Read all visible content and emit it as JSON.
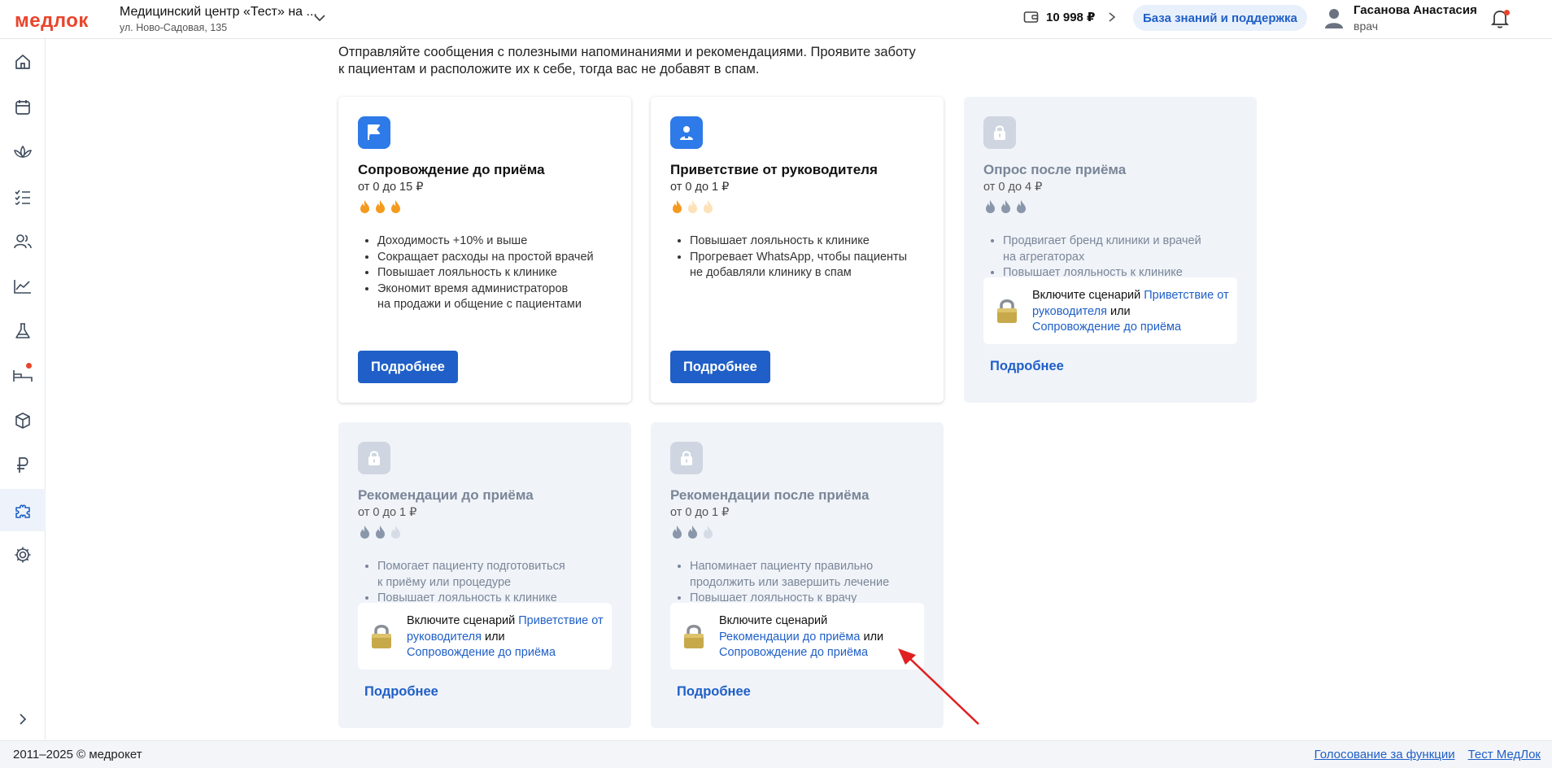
{
  "header": {
    "logo": "медлок",
    "clinic_name": "Медицинский центр «Тест» на ...",
    "clinic_address": "ул. Ново-Садовая, 135",
    "balance": "10 998 ₽",
    "knowledge_button": "База знаний и поддержка",
    "user_name": "Гасанова Анастасия",
    "user_role": "врач"
  },
  "sidebar": {
    "items": [
      "home-icon",
      "calendar-icon",
      "lotus-icon",
      "checklist-icon",
      "users-icon",
      "chart-icon",
      "flask-icon",
      "bed-icon",
      "box-icon",
      "ruble-icon",
      "puzzle-icon",
      "settings-icon"
    ],
    "active": "puzzle-icon",
    "expand_icon": "chevron-right-icon"
  },
  "intro": {
    "line1": "Отправляйте сообщения с полезными напоминаниями и рекомендациями. Проявите заботу",
    "line2": "к пациентам и расположите их к себе, тогда вас не добавят в спам."
  },
  "cards": [
    {
      "title": "Сопровождение до приёма",
      "price": "от 0 до 15 ₽",
      "flames_active": 3,
      "benefits": [
        "Доходимость +10% и выше",
        "Сокращает расходы на простой врачей",
        "Повышает лояльность к клинике",
        "Экономит время администраторов",
        "на продажи и общение с пациентами"
      ],
      "button": "Подробнее",
      "locked": false
    },
    {
      "title": "Приветствие от руководителя",
      "price": "от 0 до 1 ₽",
      "flames_active": 1,
      "benefits": [
        "Повышает лояльность к клинике",
        "Прогревает WhatsApp, чтобы пациенты",
        "не добавляли клинику в спам"
      ],
      "button": "Подробнее",
      "locked": false
    },
    {
      "title": "Опрос после приёма",
      "price": "от 0 до 4 ₽",
      "flames_active": 3,
      "benefits": [
        "Продвигает бренд клиники и врачей",
        "на агрегаторах",
        "Повышает лояльность к клинике"
      ],
      "lock": {
        "prefix": "Включите сценарий ",
        "link1": "Приветствие от руководителя",
        "middle": " или ",
        "link2": "Сопровождение до приёма"
      },
      "button": "Подробнее",
      "locked": true
    },
    {
      "title": "Рекомендации до приёма",
      "price": "от 0 до 1 ₽",
      "flames_active": 2,
      "benefits": [
        "Помогает пациенту подготовиться",
        "к приёму или процедуре",
        "Повышает лояльность к клинике"
      ],
      "lock": {
        "prefix": "Включите сценарий ",
        "link1": "Приветствие от руководителя",
        "middle": " или ",
        "link2": "Сопровождение до приёма"
      },
      "button": "Подробнее",
      "locked": true
    },
    {
      "title": "Рекомендации после приёма",
      "price": "от 0 до 1 ₽",
      "flames_active": 2,
      "benefits": [
        "Напоминает пациенту правильно",
        "продолжить или завершить лечение",
        "Повышает лояльность к врачу"
      ],
      "lock": {
        "prefix": "Включите сценарий",
        "link1": "Рекомендации до приёма",
        "middle": " или",
        "link2": "Сопровождение до приёма"
      },
      "button": "Подробнее",
      "locked": true
    }
  ],
  "footer": {
    "copyright": "2011–2025 © медрокет",
    "link1": "Голосование за функции",
    "link2": "Тест МедЛок"
  },
  "colors": {
    "brand": "#e8452c",
    "primary": "#1f5fc7",
    "flame_active": "#f49b1f",
    "flame_inactive": "#fde2b8",
    "annotation_arrow": "#e02020"
  }
}
